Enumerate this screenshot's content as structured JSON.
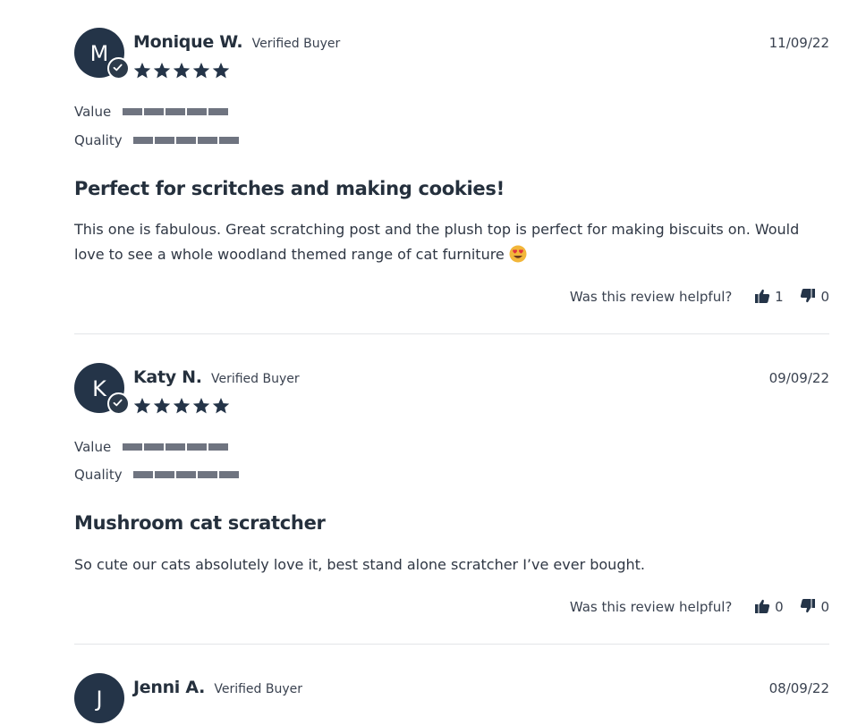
{
  "reviews": [
    {
      "initial": "M",
      "name": "Monique W.",
      "verified": "Verified Buyer",
      "date": "11/09/22",
      "rating": 5,
      "value_label": "Value",
      "value_level": 5,
      "quality_label": "Quality",
      "quality_level": 5,
      "title": "Perfect for scritches and making cookies!",
      "body": "This one is fabulous. Great scratching post and the plush top is perfect for making biscuits on. Would love to see a whole woodland themed range of cat furniture",
      "body_emoji": "heart-eyes-emoji",
      "helpful_prompt": "Was this review helpful?",
      "up_count": "1",
      "down_count": "0"
    },
    {
      "initial": "K",
      "name": "Katy N.",
      "verified": "Verified Buyer",
      "date": "09/09/22",
      "rating": 5,
      "value_label": "Value",
      "value_level": 5,
      "quality_label": "Quality",
      "quality_level": 5,
      "title": "Mushroom cat scratcher",
      "body": "So cute our cats absolutely love it, best stand alone scratcher I’ve ever bought.",
      "helpful_prompt": "Was this review helpful?",
      "up_count": "0",
      "down_count": "0"
    },
    {
      "initial": "J",
      "name": "Jenni A.",
      "verified": "Verified Buyer",
      "date": "08/09/22"
    }
  ],
  "colors": {
    "avatar": "#243448",
    "star": "#243448",
    "bar": "#6f7480",
    "divider": "#e3e5e8"
  },
  "icons": {
    "star": "star-icon",
    "verified": "checkmark-icon",
    "thumbs_up": "thumbs-up-icon",
    "thumbs_down": "thumbs-down-icon"
  }
}
